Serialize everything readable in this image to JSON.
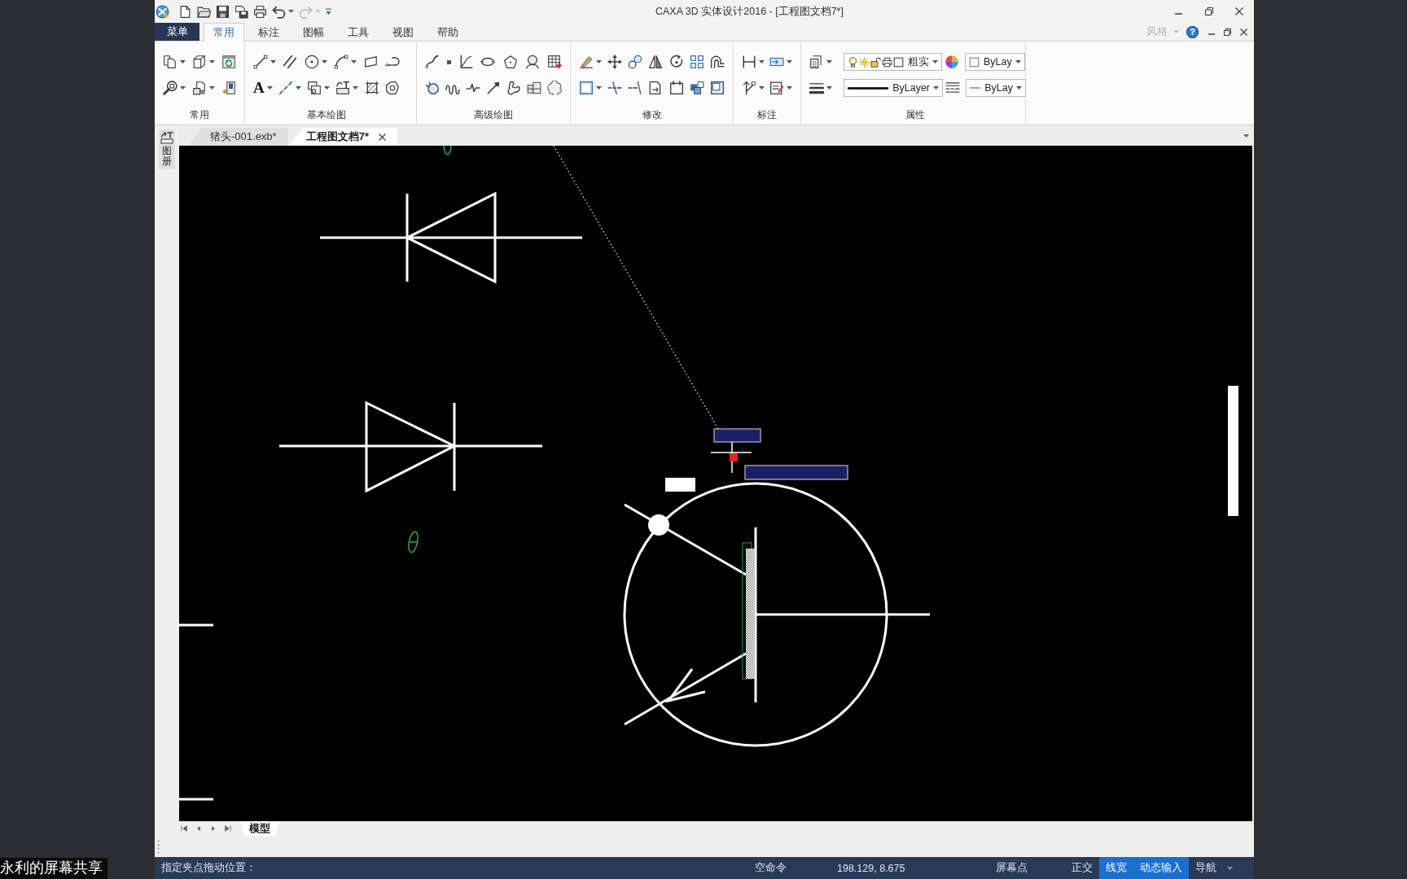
{
  "title_bar": {
    "title": "CAXA 3D 实体设计2016 - [工程图文档7*]"
  },
  "quick_access": {
    "redo": {
      "disabled": true
    }
  },
  "menu_button": {
    "label": "菜单"
  },
  "ribbon_tabs": [
    {
      "label": "常用",
      "selected": true
    },
    {
      "label": "标注",
      "selected": false
    },
    {
      "label": "图幅",
      "selected": false
    },
    {
      "label": "工具",
      "selected": false
    },
    {
      "label": "视图",
      "selected": false
    },
    {
      "label": "帮助",
      "selected": false
    }
  ],
  "style_menu": {
    "label": "风格",
    "disabled": true
  },
  "help_button": {
    "label": "?"
  },
  "ribbon_groups": [
    {
      "kind": "tools",
      "label": "常用"
    },
    {
      "kind": "tools",
      "label": "基本绘图",
      "text_tool": "A"
    },
    {
      "kind": "tools",
      "label": "高级绘图"
    },
    {
      "kind": "tools",
      "label": "修改"
    },
    {
      "kind": "tools",
      "label": "标注"
    },
    {
      "kind": "properties",
      "label": "属性",
      "layer": "粗实",
      "color_setting": "ByLay",
      "linetype": "ByLayer",
      "line_color_setting": "ByLay"
    }
  ],
  "side_panel": {
    "label": "图册"
  },
  "document_tabs": [
    {
      "label": "猪头-001.exb*",
      "selected": false
    },
    {
      "label": "工程图文档7*",
      "selected": true
    }
  ],
  "layout_tabs": [
    {
      "label": "模型",
      "selected": true
    }
  ],
  "status_bar": {
    "prompt": "指定夹点拖动位置：",
    "command": "空命令",
    "coordinates": "198.129, 8.675",
    "snap_mode": "屏幕点",
    "toggles": [
      {
        "label": "正交",
        "on": false
      },
      {
        "label": "线宽",
        "on": true
      },
      {
        "label": "动态输入",
        "on": true
      },
      {
        "label": "导航",
        "on": false
      }
    ]
  },
  "desktop": {
    "screen_share_label": "永利的屏幕共享"
  }
}
